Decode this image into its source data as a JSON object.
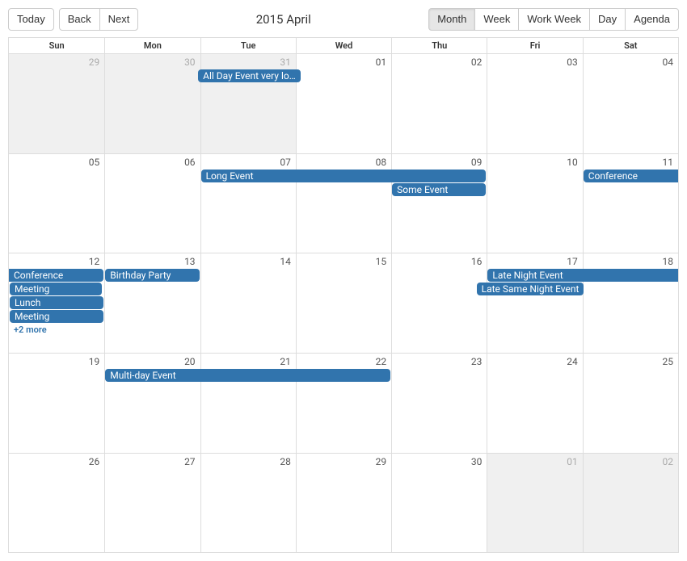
{
  "toolbar": {
    "today": "Today",
    "back": "Back",
    "next": "Next",
    "title": "2015 April",
    "views": {
      "month": "Month",
      "week": "Week",
      "workweek": "Work Week",
      "day": "Day",
      "agenda": "Agenda"
    }
  },
  "dayHeaders": [
    "Sun",
    "Mon",
    "Tue",
    "Wed",
    "Thu",
    "Fri",
    "Sat"
  ],
  "weeks": [
    {
      "days": [
        {
          "num": "29",
          "off": true
        },
        {
          "num": "30",
          "off": true
        },
        {
          "num": "31",
          "off": true
        },
        {
          "num": "01",
          "off": false
        },
        {
          "num": "02",
          "off": false
        },
        {
          "num": "03",
          "off": false
        },
        {
          "num": "04",
          "off": false
        }
      ]
    },
    {
      "days": [
        {
          "num": "05",
          "off": false
        },
        {
          "num": "06",
          "off": false
        },
        {
          "num": "07",
          "off": false
        },
        {
          "num": "08",
          "off": false
        },
        {
          "num": "09",
          "off": false
        },
        {
          "num": "10",
          "off": false
        },
        {
          "num": "11",
          "off": false
        }
      ]
    },
    {
      "days": [
        {
          "num": "12",
          "off": false
        },
        {
          "num": "13",
          "off": false
        },
        {
          "num": "14",
          "off": false
        },
        {
          "num": "15",
          "off": false
        },
        {
          "num": "16",
          "off": false
        },
        {
          "num": "17",
          "off": false
        },
        {
          "num": "18",
          "off": false
        }
      ]
    },
    {
      "days": [
        {
          "num": "19",
          "off": false
        },
        {
          "num": "20",
          "off": false
        },
        {
          "num": "21",
          "off": false
        },
        {
          "num": "22",
          "off": false
        },
        {
          "num": "23",
          "off": false
        },
        {
          "num": "24",
          "off": false
        },
        {
          "num": "25",
          "off": false
        }
      ]
    },
    {
      "days": [
        {
          "num": "26",
          "off": false
        },
        {
          "num": "27",
          "off": false
        },
        {
          "num": "28",
          "off": false
        },
        {
          "num": "29",
          "off": false
        },
        {
          "num": "30",
          "off": false
        },
        {
          "num": "01",
          "off": true
        },
        {
          "num": "02",
          "off": true
        }
      ]
    },
    {
      "days": []
    }
  ],
  "events": {
    "allday": "All Day Event very lo…",
    "longevent": "Long Event",
    "someevent": "Some Event",
    "conference": "Conference",
    "meeting": "Meeting",
    "lunch": "Lunch",
    "birthday": "Birthday Party",
    "latenight": "Late Night Event",
    "latesame": "Late Same Night Event",
    "multiday": "Multi-day Event",
    "more2": "+2 more"
  }
}
